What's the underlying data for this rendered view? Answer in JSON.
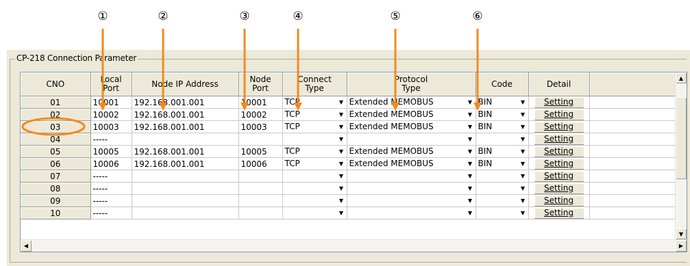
{
  "callouts": [
    "①",
    "②",
    "③",
    "④",
    "⑤",
    "⑥"
  ],
  "annotation_color": "#f28a1c",
  "group_title": "CP-218 Connection Parameter",
  "columns": {
    "cno": "CNO",
    "local_port": "Local\nPort",
    "node_ip": "Node IP Address",
    "node_port": "Node\nPort",
    "connect_type": "Connect\nType",
    "protocol_type": "Protocol\nType",
    "code": "Code",
    "detail": "Detail"
  },
  "rows": [
    {
      "cno": "01",
      "local_port": "10001",
      "node_ip": "192.168.001.001",
      "node_port": "10001",
      "connect_type": "TCP",
      "protocol_type": "Extended MEMOBUS",
      "code": "BIN",
      "detail": "Setting"
    },
    {
      "cno": "02",
      "local_port": "10002",
      "node_ip": "192.168.001.001",
      "node_port": "10002",
      "connect_type": "TCP",
      "protocol_type": "Extended MEMOBUS",
      "code": "BIN",
      "detail": "Setting"
    },
    {
      "cno": "03",
      "local_port": "10003",
      "node_ip": "192.168.001.001",
      "node_port": "10003",
      "connect_type": "TCP",
      "protocol_type": "Extended MEMOBUS",
      "code": "BIN",
      "detail": "Setting"
    },
    {
      "cno": "04",
      "local_port": "-----",
      "node_ip": "",
      "node_port": "",
      "connect_type": "",
      "protocol_type": "",
      "code": "",
      "detail": "Setting"
    },
    {
      "cno": "05",
      "local_port": "10005",
      "node_ip": "192.168.001.001",
      "node_port": "10005",
      "connect_type": "TCP",
      "protocol_type": "Extended MEMOBUS",
      "code": "BIN",
      "detail": "Setting"
    },
    {
      "cno": "06",
      "local_port": "10006",
      "node_ip": "192.168.001.001",
      "node_port": "10006",
      "connect_type": "TCP",
      "protocol_type": "Extended MEMOBUS",
      "code": "BIN",
      "detail": "Setting"
    },
    {
      "cno": "07",
      "local_port": "-----",
      "node_ip": "",
      "node_port": "",
      "connect_type": "",
      "protocol_type": "",
      "code": "",
      "detail": "Setting"
    },
    {
      "cno": "08",
      "local_port": "-----",
      "node_ip": "",
      "node_port": "",
      "connect_type": "",
      "protocol_type": "",
      "code": "",
      "detail": "Setting"
    },
    {
      "cno": "09",
      "local_port": "-----",
      "node_ip": "",
      "node_port": "",
      "connect_type": "",
      "protocol_type": "",
      "code": "",
      "detail": "Setting"
    },
    {
      "cno": "10",
      "local_port": "-----",
      "node_ip": "",
      "node_port": "",
      "connect_type": "",
      "protocol_type": "",
      "code": "",
      "detail": "Setting"
    }
  ],
  "highlighted_row": "02",
  "icons": {
    "dropdown": "dropdown-arrow-icon",
    "scroll_up": "scroll-up-arrow-icon",
    "scroll_down": "scroll-down-arrow-icon",
    "scroll_left": "scroll-left-arrow-icon",
    "scroll_right": "scroll-right-arrow-icon"
  }
}
